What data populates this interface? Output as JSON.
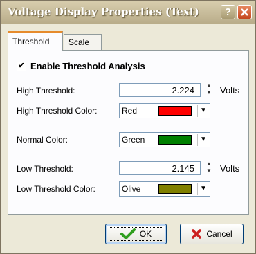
{
  "window": {
    "title": "Voltage Display Properties (Text)",
    "help_icon": "question-mark-icon",
    "close_icon": "close-icon"
  },
  "tabs": [
    {
      "label": "Threshold",
      "active": true
    },
    {
      "label": "Scale",
      "active": false
    }
  ],
  "threshold": {
    "enable_label": "Enable Threshold Analysis",
    "enable_checked": true,
    "check_glyph": "✔",
    "high_label": "High Threshold:",
    "high_value": "2.224",
    "high_unit": "Volts",
    "high_color_label": "High Threshold Color:",
    "high_color_name": "Red",
    "high_color_hex": "#ff0000",
    "normal_color_label": "Normal Color:",
    "normal_color_name": "Green",
    "normal_color_hex": "#008000",
    "low_label": "Low Threshold:",
    "low_value": "2.145",
    "low_unit": "Volts",
    "low_color_label": "Low Threshold Color:",
    "low_color_name": "Olive",
    "low_color_hex": "#808000"
  },
  "buttons": {
    "ok_label": "OK",
    "ok_icon": "checkmark-icon",
    "cancel_label": "Cancel",
    "cancel_icon": "x-icon"
  }
}
